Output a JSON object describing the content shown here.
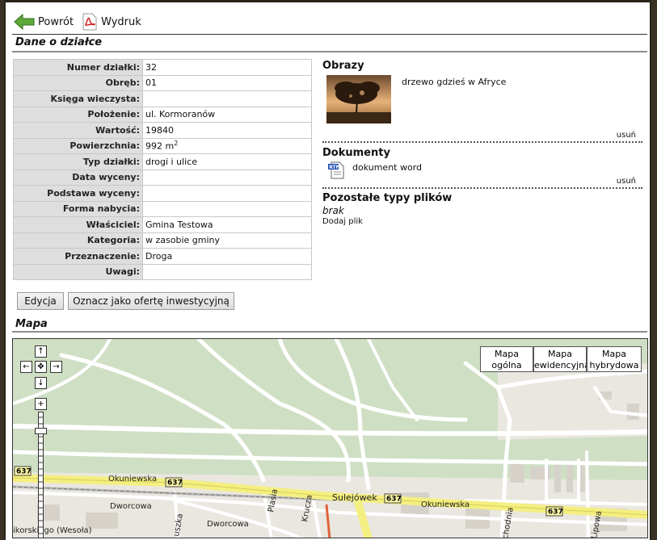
{
  "toolbar": {
    "back_label": "Powrót",
    "print_label": "Wydruk"
  },
  "sections": {
    "details_title": "Dane o działce",
    "map_title": "Mapa"
  },
  "details": [
    {
      "label": "Numer działki:",
      "value": "32"
    },
    {
      "label": "Obręb:",
      "value": "01"
    },
    {
      "label": "Księga wieczysta:",
      "value": ""
    },
    {
      "label": "Położenie:",
      "value": "ul. Kormoranów"
    },
    {
      "label": "Wartość:",
      "value": "19840"
    },
    {
      "label": "Powierzchnia:",
      "value": "992 m",
      "sup": "2"
    },
    {
      "label": "Typ działki:",
      "value": "drogi i ulice"
    },
    {
      "label": "Data wyceny:",
      "value": ""
    },
    {
      "label": "Podstawa wyceny:",
      "value": ""
    },
    {
      "label": "Forma nabycia:",
      "value": ""
    },
    {
      "label": "Właściciel:",
      "value": "Gmina Testowa"
    },
    {
      "label": "Kategoria:",
      "value": "w zasobie gminy"
    },
    {
      "label": "Przeznaczenie:",
      "value": "Droga"
    },
    {
      "label": "Uwagi:",
      "value": ""
    }
  ],
  "buttons": {
    "edit": "Edycja",
    "investment": "Oznacz jako ofertę inwestycyjną"
  },
  "images": {
    "title": "Obrazy",
    "caption": "drzewo gdzieś w Afryce",
    "remove": "usuń"
  },
  "documents": {
    "title": "Dokumenty",
    "name": "dokument word",
    "remove": "usuń",
    "icon_text": "RTF"
  },
  "other": {
    "title": "Pozostałe typy plików",
    "empty": "brak",
    "add": "Dodaj plik"
  },
  "map": {
    "type_general": [
      "Mapa",
      "ogólna"
    ],
    "type_cadastral": [
      "Mapa",
      "ewidencyjna"
    ],
    "type_hybrid": [
      "Mapa",
      "hybrydowa"
    ],
    "streets": {
      "okuniewska_1": "Okuniewska",
      "okuniewska_2": "Okuniewska",
      "sulejowek": "Sulejówek",
      "dworcowa_1": "Dworcowa",
      "dworcowa_2": "Dworcowa",
      "plasia": "Plasia",
      "krucza": "Krucza",
      "uszka": "uszka",
      "wesola": "ikorskiego (Wesoła)",
      "chodnia": "chodnia",
      "lipowa": "Lipowa"
    },
    "route_number": "637",
    "colors": {
      "park": "#cfdfc4",
      "land": "#eae7e0",
      "road": "#ffffff",
      "main_road": "#f4ef82",
      "building": "#d6d2ca"
    }
  }
}
